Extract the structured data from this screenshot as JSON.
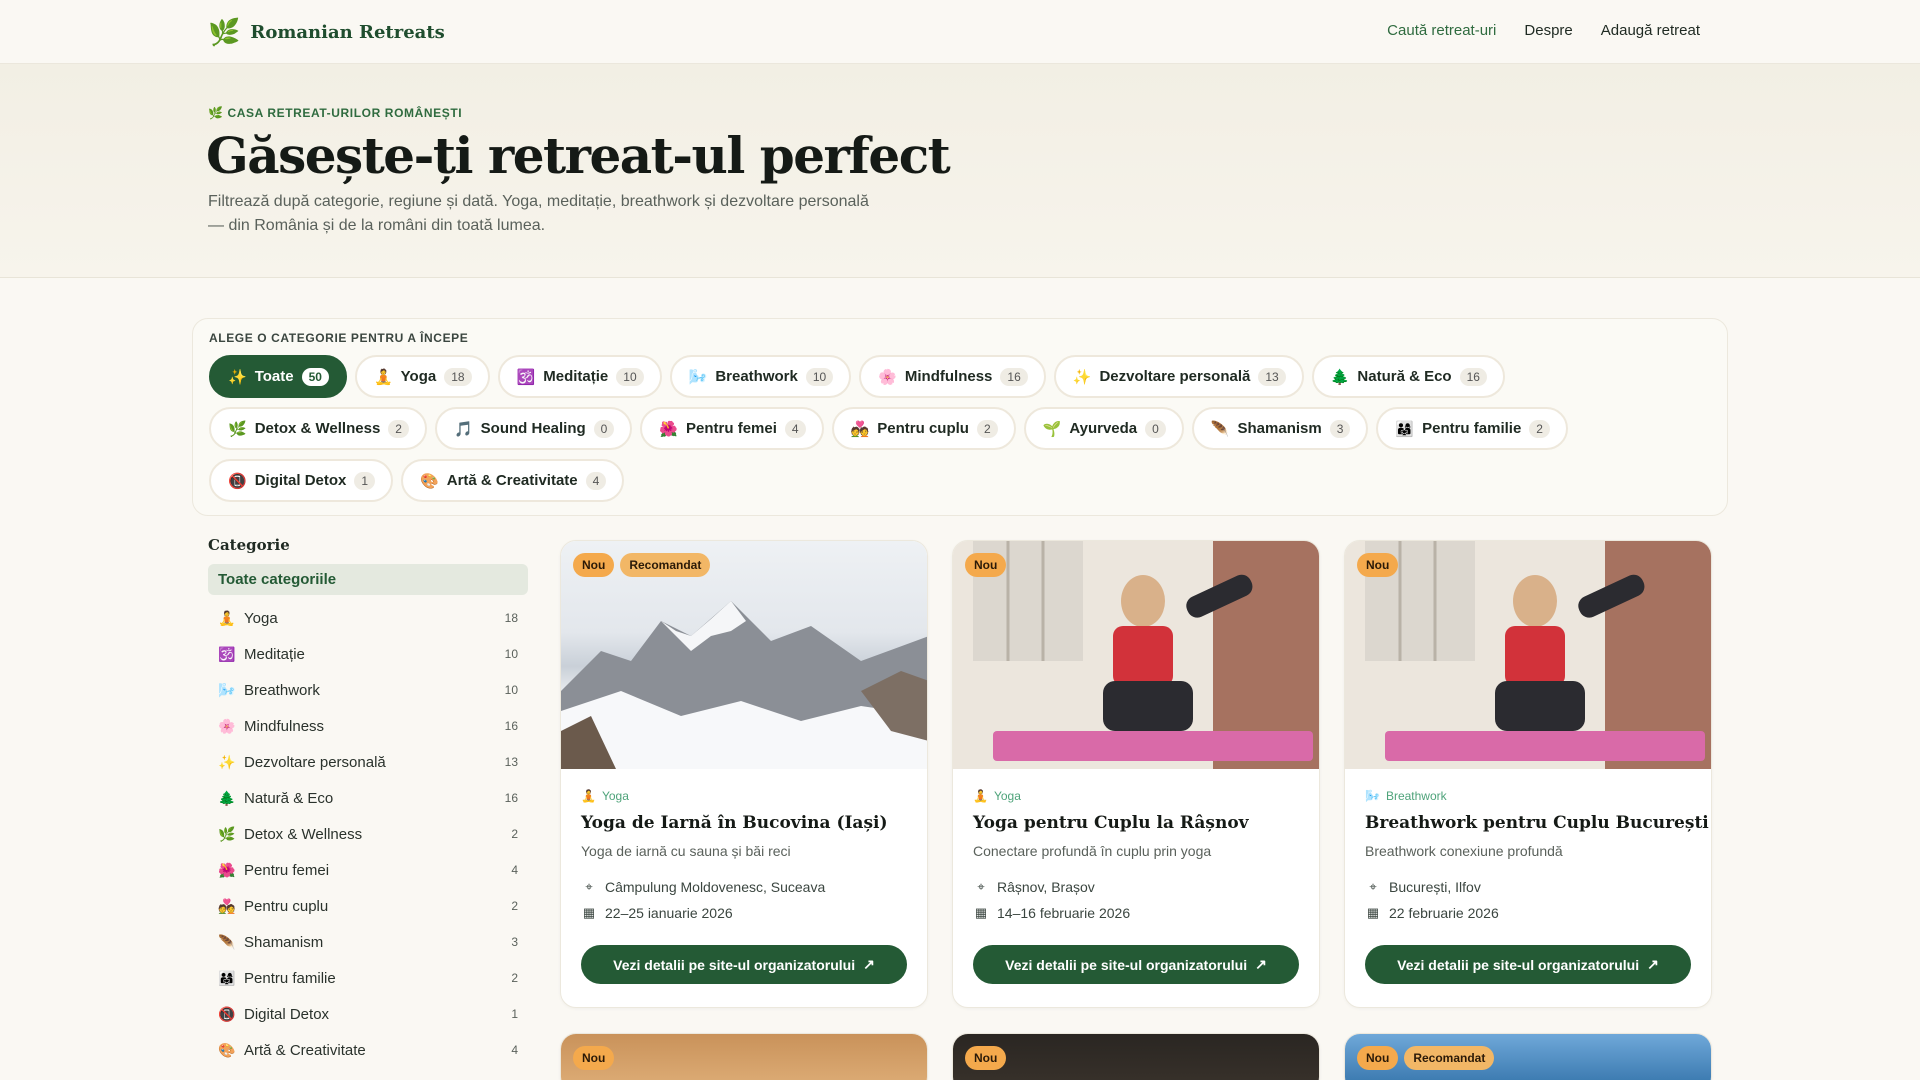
{
  "header": {
    "brand": "Romanian Retreats",
    "brand_icon": "leaf-icon",
    "nav": [
      "Caută retreat-uri",
      "Despre",
      "Adaugă retreat"
    ]
  },
  "hero": {
    "eyebrow": "🌿 CASA RETREAT-URILOR ROMÂNEȘTI",
    "title": "Găsește-ți retreat-ul perfect",
    "subtitle": "Filtrează după categorie, regiune și dată. Yoga, meditație, breathwork și dezvoltare personală — din România și de la români din toată lumea."
  },
  "categories_panel": {
    "title": "ALEGE O CATEGORIE PENTRU A ÎNCEPE",
    "chips": [
      {
        "icon": "✨",
        "label": "Toate",
        "count": "50"
      },
      {
        "icon": "🧘",
        "label": "Yoga",
        "count": "18"
      },
      {
        "icon": "🕉️",
        "label": "Meditație",
        "count": "10"
      },
      {
        "icon": "🌬️",
        "label": "Breathwork",
        "count": "10"
      },
      {
        "icon": "🌸",
        "label": "Mindfulness",
        "count": "16"
      },
      {
        "icon": "✨",
        "label": "Dezvoltare personală",
        "count": "13"
      },
      {
        "icon": "🌲",
        "label": "Natură & Eco",
        "count": "16"
      },
      {
        "icon": "🌿",
        "label": "Detox & Wellness",
        "count": "2"
      },
      {
        "icon": "🎵",
        "label": "Sound Healing",
        "count": "0"
      },
      {
        "icon": "🌺",
        "label": "Pentru femei",
        "count": "4"
      },
      {
        "icon": "💑",
        "label": "Pentru cuplu",
        "count": "2"
      },
      {
        "icon": "🌱",
        "label": "Ayurveda",
        "count": "0"
      },
      {
        "icon": "🪶",
        "label": "Shamanism",
        "count": "3"
      },
      {
        "icon": "👨‍👩‍👧",
        "label": "Pentru familie",
        "count": "2"
      },
      {
        "icon": "📵",
        "label": "Digital Detox",
        "count": "1"
      },
      {
        "icon": "🎨",
        "label": "Artă & Creativitate",
        "count": "4"
      }
    ]
  },
  "sidebar": {
    "title": "Categorie",
    "all_label": "Toate categoriile",
    "items": [
      {
        "icon": "🧘",
        "label": "Yoga",
        "count": "18"
      },
      {
        "icon": "🕉️",
        "label": "Meditație",
        "count": "10"
      },
      {
        "icon": "🌬️",
        "label": "Breathwork",
        "count": "10"
      },
      {
        "icon": "🌸",
        "label": "Mindfulness",
        "count": "16"
      },
      {
        "icon": "✨",
        "label": "Dezvoltare personală",
        "count": "13"
      },
      {
        "icon": "🌲",
        "label": "Natură & Eco",
        "count": "16"
      },
      {
        "icon": "🌿",
        "label": "Detox & Wellness",
        "count": "2"
      },
      {
        "icon": "🌺",
        "label": "Pentru femei",
        "count": "4"
      },
      {
        "icon": "💑",
        "label": "Pentru cuplu",
        "count": "2"
      },
      {
        "icon": "🪶",
        "label": "Shamanism",
        "count": "3"
      },
      {
        "icon": "👨‍👩‍👧",
        "label": "Pentru familie",
        "count": "2"
      },
      {
        "icon": "📵",
        "label": "Digital Detox",
        "count": "1"
      },
      {
        "icon": "🎨",
        "label": "Artă & Creativitate",
        "count": "4"
      }
    ]
  },
  "cards": [
    {
      "badges": [
        "Nou",
        "Recomandat"
      ],
      "category_icon": "🧘",
      "category": "Yoga",
      "title": "Yoga de Iarnă în Bucovina (Iași)",
      "description": "Yoga de iarnă cu sauna și băi reci",
      "location": "Câmpulung Moldovenesc, Suceava",
      "dates": "22–25 ianuarie 2026",
      "button": "Vezi detalii pe site-ul organizatorului"
    },
    {
      "badges": [
        "Nou"
      ],
      "category_icon": "🧘",
      "category": "Yoga",
      "title": "Yoga pentru Cuplu la Râșnov",
      "description": "Conectare profundă în cuplu prin yoga",
      "location": "Râșnov, Brașov",
      "dates": "14–16 februarie 2026",
      "button": "Vezi detalii pe site-ul organizatorului"
    },
    {
      "badges": [
        "Nou"
      ],
      "category_icon": "🌬️",
      "category": "Breathwork",
      "title": "Breathwork pentru Cuplu București",
      "description": "Breathwork conexiune profundă",
      "location": "București, Ilfov",
      "dates": "22 februarie 2026",
      "button": "Vezi detalii pe site-ul organizatorului"
    }
  ],
  "next_row_badges": [
    [
      "Nou"
    ],
    [
      "Nou"
    ],
    [
      "Nou",
      "Recomandat"
    ]
  ],
  "colors": {
    "accent": "#245a35",
    "badge": "#f4a94c",
    "background": "#faf8f3"
  }
}
